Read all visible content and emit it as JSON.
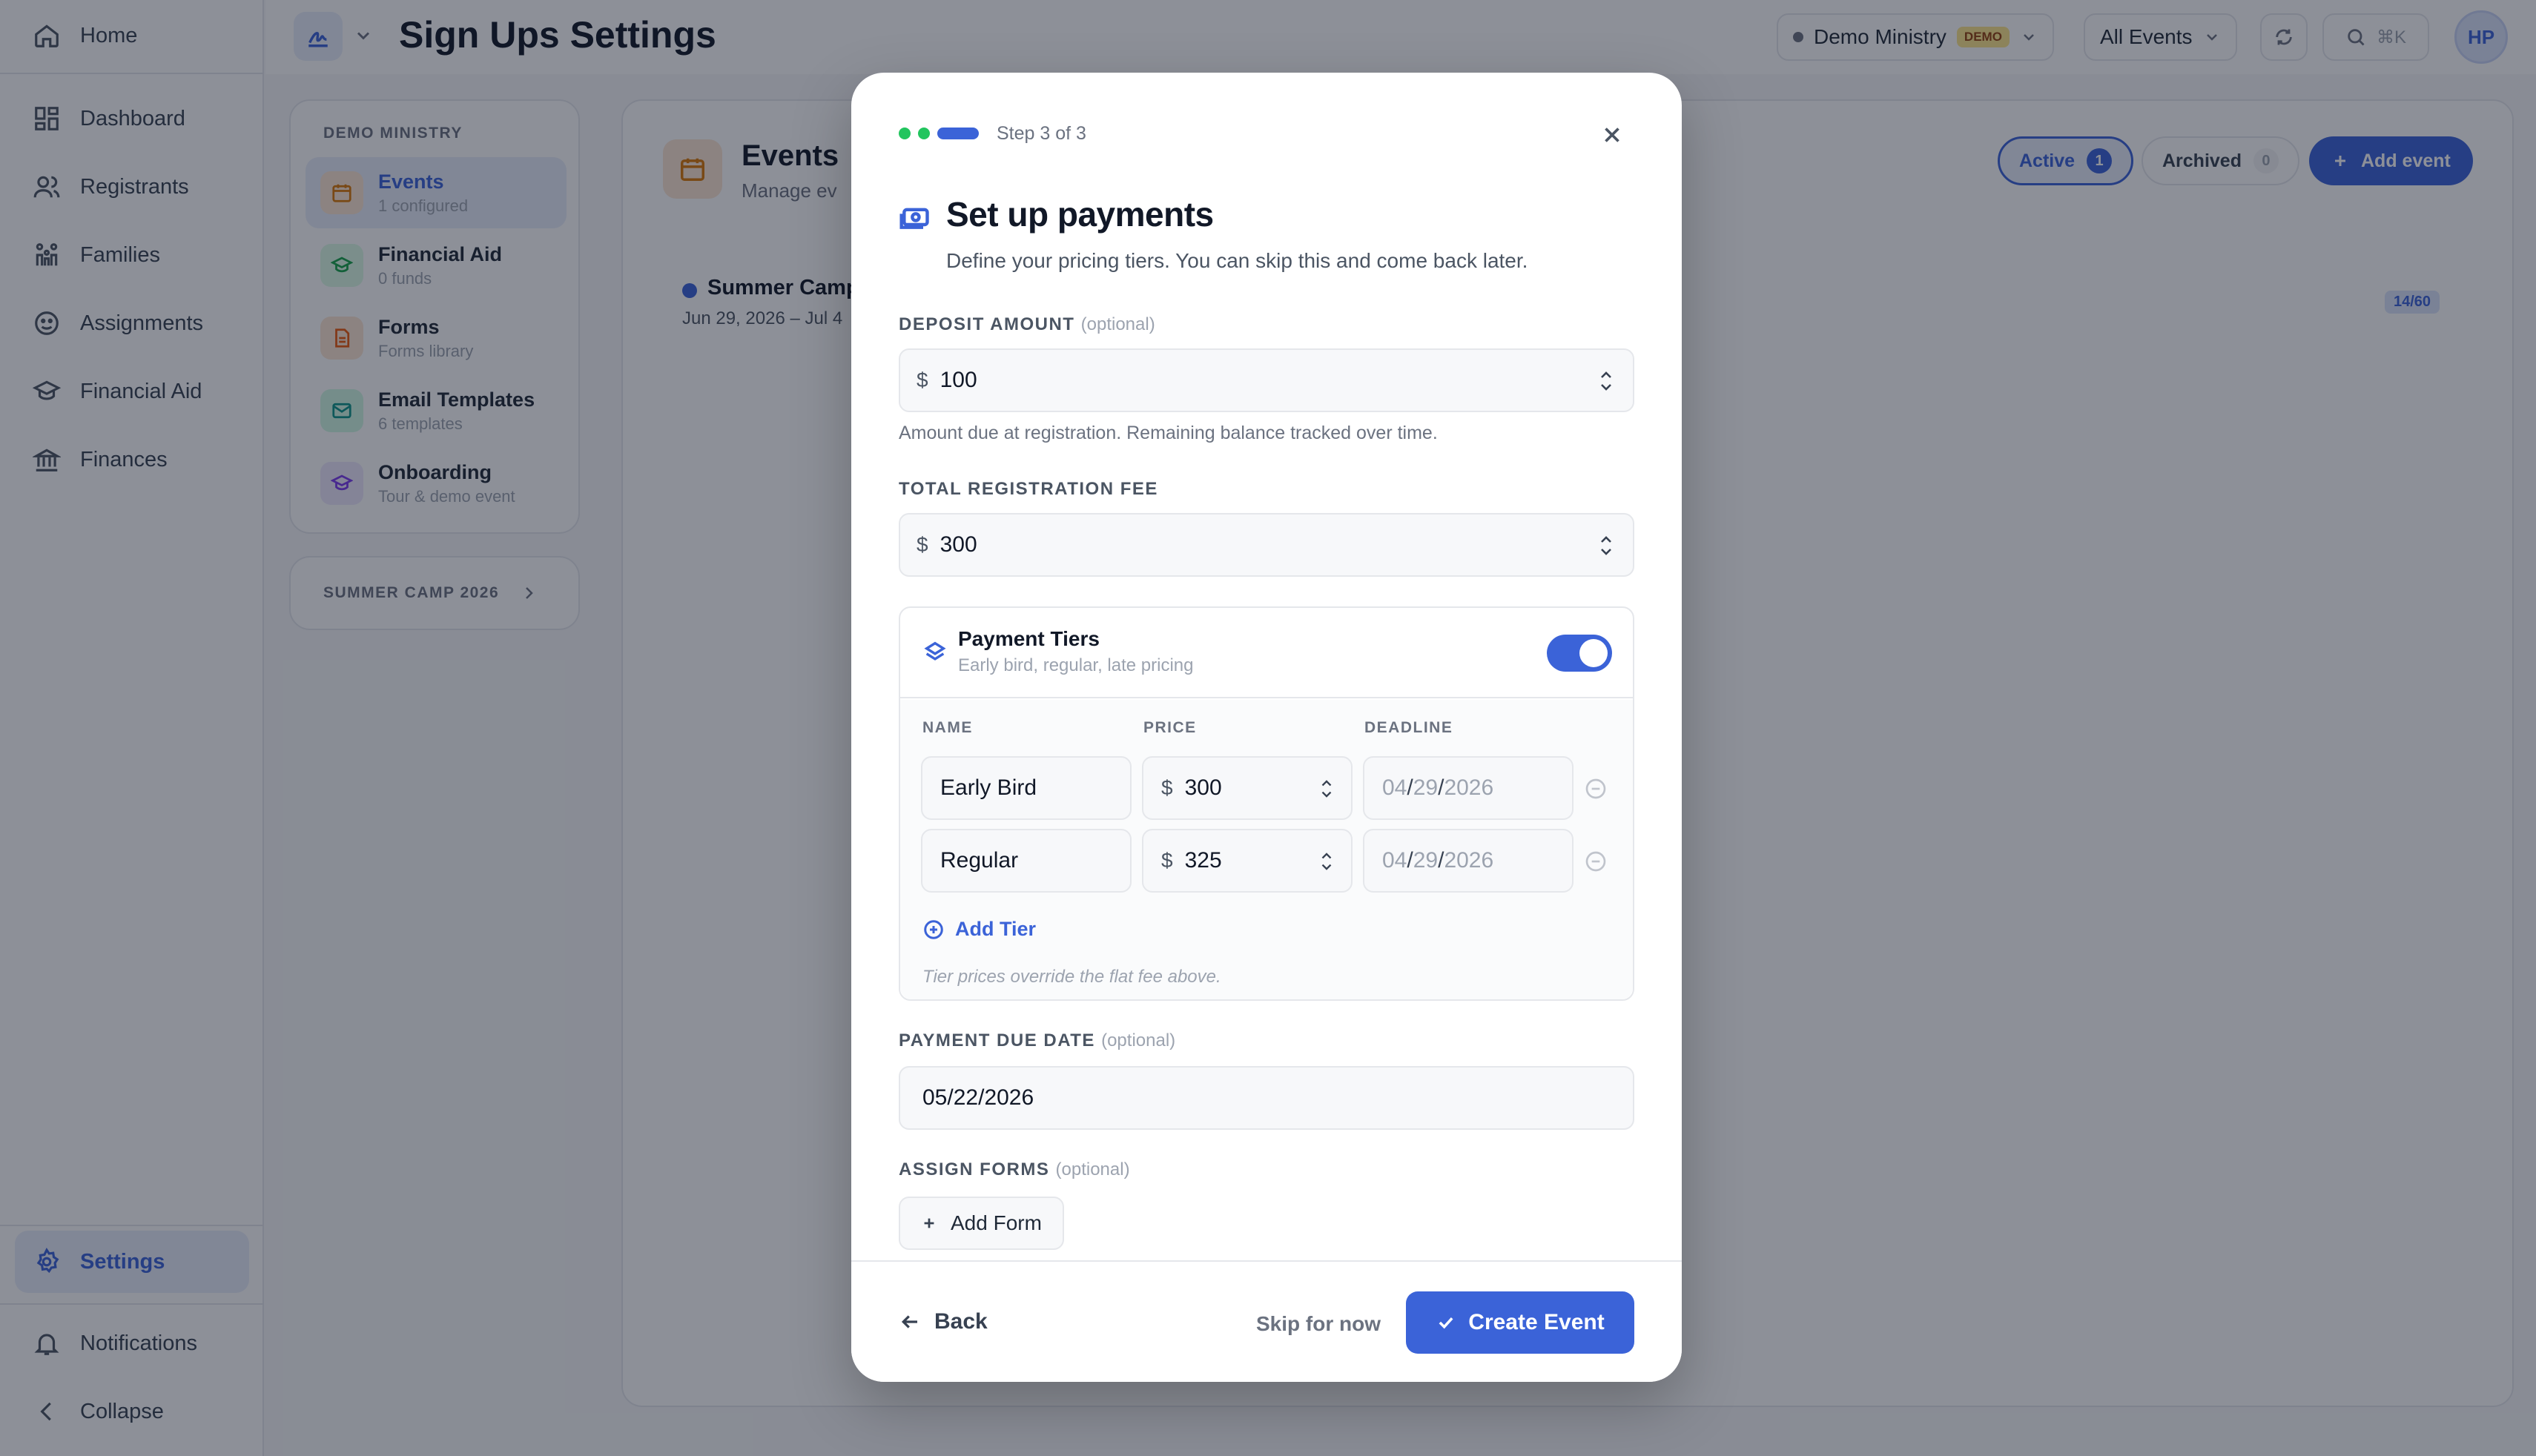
{
  "sidebar": {
    "items": [
      {
        "label": "Home",
        "icon": "home-icon"
      },
      {
        "label": "Dashboard",
        "icon": "dashboard-icon"
      },
      {
        "label": "Registrants",
        "icon": "users-icon"
      },
      {
        "label": "Families",
        "icon": "family-icon"
      },
      {
        "label": "Assignments",
        "icon": "assignments-icon"
      },
      {
        "label": "Financial Aid",
        "icon": "graduation-cap-icon"
      },
      {
        "label": "Finances",
        "icon": "bank-icon"
      }
    ],
    "settings_label": "Settings",
    "notifications_label": "Notifications",
    "collapse_label": "Collapse"
  },
  "header": {
    "title": "Sign Ups Settings",
    "org_name": "Demo Ministry",
    "org_badge": "DEMO",
    "event_filter": "All Events",
    "search_shortcut": "⌘K",
    "avatar_initials": "HP"
  },
  "settings_nav": {
    "heading": "DEMO MINISTRY",
    "items": [
      {
        "title": "Events",
        "desc": "1 configured"
      },
      {
        "title": "Financial Aid",
        "desc": "0 funds"
      },
      {
        "title": "Forms",
        "desc": "Forms library"
      },
      {
        "title": "Email Templates",
        "desc": "6 templates"
      },
      {
        "title": "Onboarding",
        "desc": "Tour & demo event"
      }
    ],
    "camp_card": "SUMMER CAMP 2026"
  },
  "events_panel": {
    "title": "Events",
    "subtitle": "Manage ev",
    "active_label": "Active",
    "active_count": "1",
    "archived_label": "Archived",
    "archived_count": "0",
    "add_event_label": "Add event",
    "event_title": "Summer Camp",
    "event_dates": "Jun 29, 2026 – Jul 4",
    "capacity": "14/60"
  },
  "modal": {
    "step_text": "Step 3 of 3",
    "title": "Set up payments",
    "subtitle": "Define your pricing tiers. You can skip this and come back later.",
    "deposit": {
      "label": "DEPOSIT AMOUNT",
      "optional": "(optional)",
      "currency": "$",
      "value": "100",
      "hint": "Amount due at registration. Remaining balance tracked over time."
    },
    "total_fee": {
      "label": "TOTAL REGISTRATION FEE",
      "currency": "$",
      "value": "300"
    },
    "tiers": {
      "title": "Payment Tiers",
      "desc": "Early bird, regular, late pricing",
      "enabled": true,
      "col_name": "NAME",
      "col_price": "PRICE",
      "col_deadline": "DEADLINE",
      "rows": [
        {
          "name": "Early Bird",
          "currency": "$",
          "price": "300",
          "mm": "04",
          "dd": "29",
          "yyyy": "2026"
        },
        {
          "name": "Regular",
          "currency": "$",
          "price": "325",
          "mm": "04",
          "dd": "29",
          "yyyy": "2026"
        }
      ],
      "add_tier_label": "Add Tier",
      "note": "Tier prices override the flat fee above."
    },
    "due_date": {
      "label": "PAYMENT DUE DATE",
      "optional": "(optional)",
      "mm": "05",
      "dd": "22",
      "yyyy": "2026"
    },
    "forms": {
      "label": "ASSIGN FORMS",
      "optional": "(optional)",
      "add_form_label": "Add Form"
    },
    "footer": {
      "back_label": "Back",
      "skip_label": "Skip for now",
      "create_label": "Create Event"
    }
  },
  "colors": {
    "accent": "#3b63d8",
    "success": "#22c55e",
    "overlay": "rgba(17,24,39,0.48)"
  }
}
